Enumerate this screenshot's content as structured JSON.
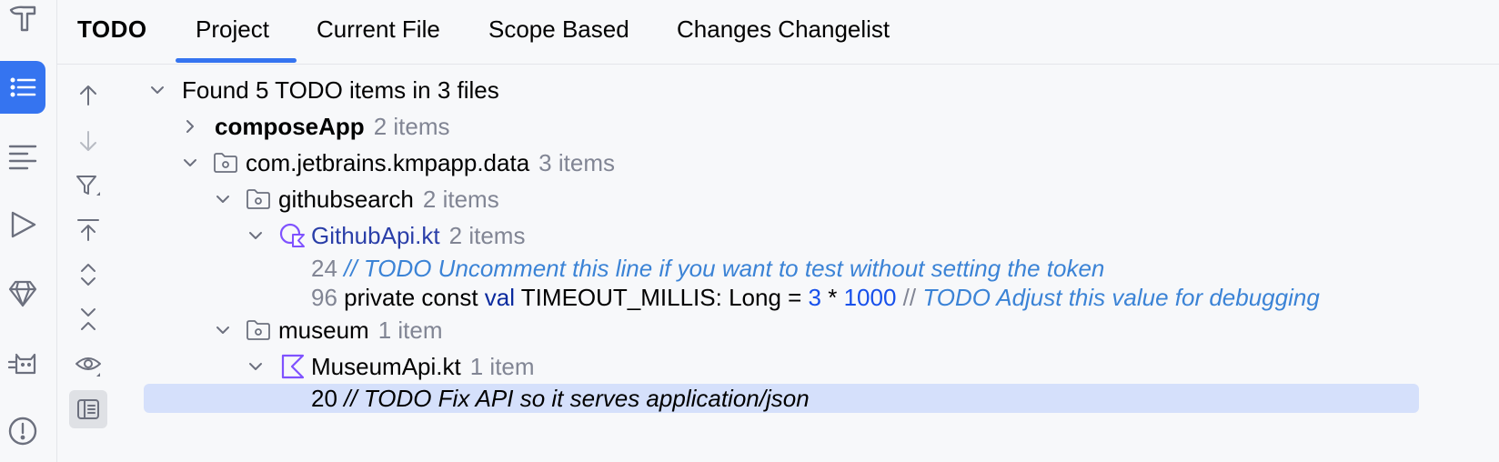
{
  "window": {
    "tool_title": "TODO"
  },
  "tabs": [
    {
      "label": "Project",
      "active": true
    },
    {
      "label": "Current File"
    },
    {
      "label": "Scope Based"
    },
    {
      "label": "Changes Changelist"
    }
  ],
  "colors": {
    "accent": "#3574f0",
    "selection": "#d5e0fb",
    "kotlin": "#7f52ff",
    "comment": "#3b83d6"
  },
  "left_strip": {
    "icons": [
      "hammer-icon",
      "todo-list-icon",
      "structure-icon",
      "run-icon",
      "gem-icon",
      "cat-icon",
      "problems-icon"
    ]
  },
  "toolbar": {
    "icons": [
      "arrow-up-icon",
      "arrow-down-icon",
      "filter-icon",
      "export-icon",
      "expand-all-icon",
      "collapse-all-icon",
      "preview-eye-icon",
      "preview-panel-icon"
    ]
  },
  "tree": {
    "summary": "Found 5 TODO items in 3 files",
    "compose_app": {
      "name": "composeApp",
      "count": "2 items"
    },
    "data_pkg": {
      "name": "com.jetbrains.kmpapp.data",
      "count": "3 items"
    },
    "githubsearch": {
      "name": "githubsearch",
      "count": "2 items"
    },
    "github_file": {
      "name": "GithubApi.kt",
      "count": "2 items"
    },
    "todo1": {
      "line": "24",
      "comment": "// TODO Uncomment this line if you want to test without setting the token"
    },
    "todo2": {
      "line": "96",
      "code_a": "private const ",
      "keyword": "val",
      "code_b": " TIMEOUT_MILLIS: Long = ",
      "num1": "3",
      "code_c": " * ",
      "num2": "1000",
      "comment_slashes": " //",
      "comment": " TODO Adjust this value for debugging"
    },
    "museum": {
      "name": "museum",
      "count": "1 item"
    },
    "museum_file": {
      "name": "MuseumApi.kt",
      "count": "1 item"
    },
    "todo3": {
      "line": "20",
      "comment": " // TODO Fix API so it serves application/json"
    }
  }
}
